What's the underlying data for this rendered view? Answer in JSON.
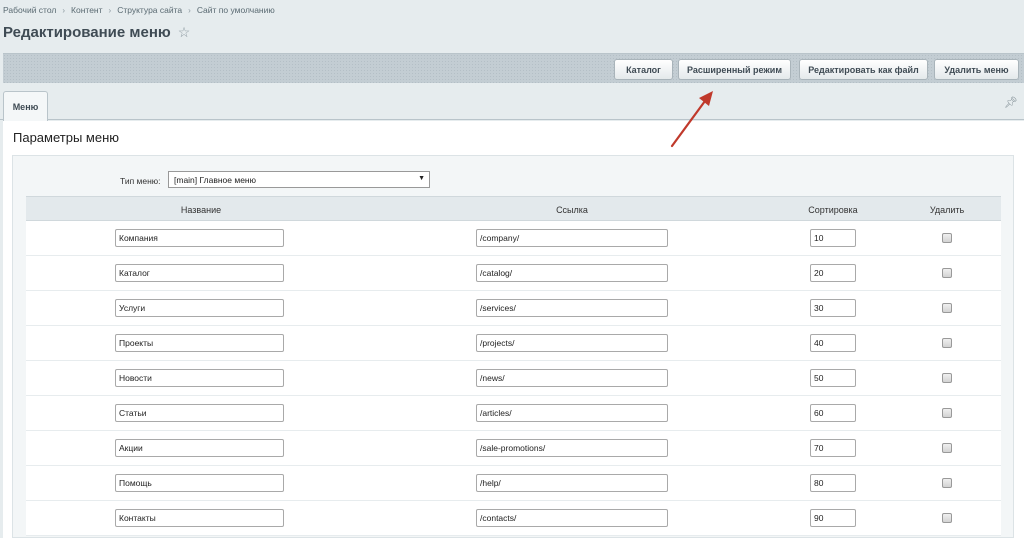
{
  "breadcrumb": [
    "Рабочий стол",
    "Контент",
    "Структура сайта",
    "Сайт по умолчанию"
  ],
  "page": {
    "title": "Редактирование меню"
  },
  "toolbar": {
    "catalog": "Каталог",
    "extended": "Расширенный режим",
    "edit_file": "Редактировать как файл",
    "delete_menu": "Удалить меню"
  },
  "tabs": {
    "active": "Меню"
  },
  "section": {
    "title": "Параметры меню"
  },
  "menu_type": {
    "label": "Тип меню:",
    "value": "[main] Главное меню"
  },
  "table": {
    "headers": {
      "name": "Название",
      "link": "Ссылка",
      "sort": "Сортировка",
      "delete": "Удалить"
    },
    "rows": [
      {
        "name": "Компания",
        "link": "/company/",
        "sort": "10"
      },
      {
        "name": "Каталог",
        "link": "/catalog/",
        "sort": "20"
      },
      {
        "name": "Услуги",
        "link": "/services/",
        "sort": "30"
      },
      {
        "name": "Проекты",
        "link": "/projects/",
        "sort": "40"
      },
      {
        "name": "Новости",
        "link": "/news/",
        "sort": "50"
      },
      {
        "name": "Статьи",
        "link": "/articles/",
        "sort": "60"
      },
      {
        "name": "Акции",
        "link": "/sale-promotions/",
        "sort": "70"
      },
      {
        "name": "Помощь",
        "link": "/help/",
        "sort": "80"
      },
      {
        "name": "Контакты",
        "link": "/contacts/",
        "sort": "90"
      }
    ]
  },
  "colors": {
    "annotation_arrow": "#c0392b",
    "toolbar_bg": "#c3cdd3",
    "page_bg": "#e6ecee"
  }
}
